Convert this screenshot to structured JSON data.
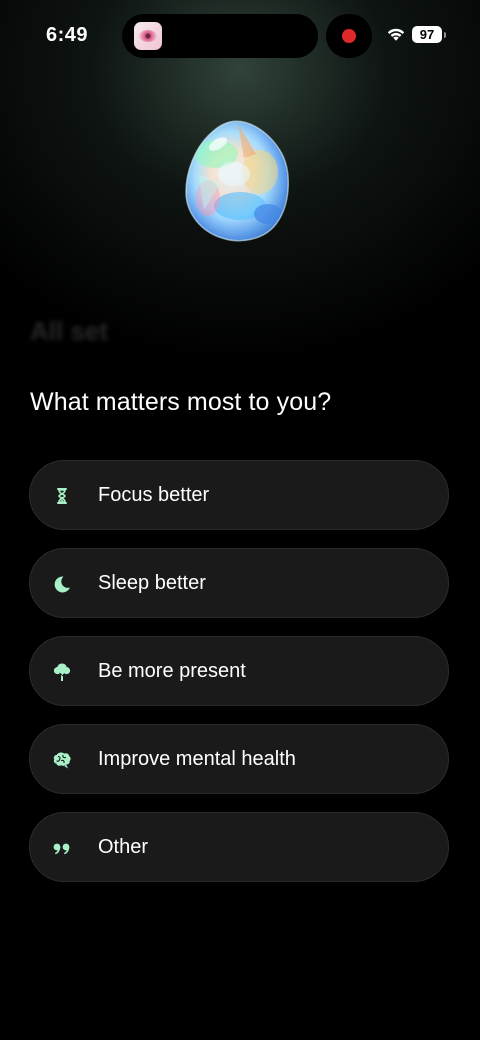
{
  "status_bar": {
    "time": "6:49",
    "battery": "97",
    "recording": true
  },
  "faded_heading": "All set",
  "question": "What matters most to you?",
  "accent_color": "#a8f0c8",
  "options": [
    {
      "label": "Focus better",
      "icon": "hourglass-icon"
    },
    {
      "label": "Sleep better",
      "icon": "crescent-moon-icon"
    },
    {
      "label": "Be more present",
      "icon": "tree-icon"
    },
    {
      "label": "Improve mental health",
      "icon": "brain-icon"
    },
    {
      "label": "Other",
      "icon": "quote-icon"
    }
  ]
}
